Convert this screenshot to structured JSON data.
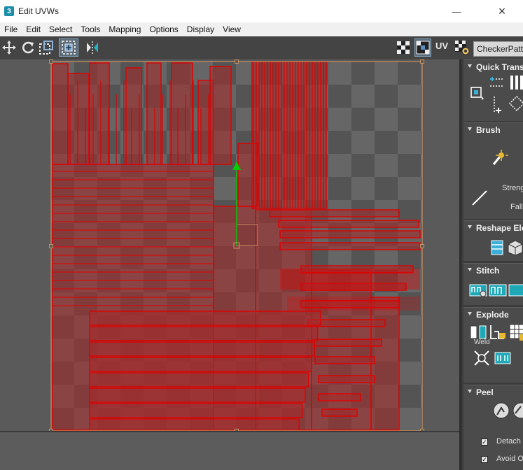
{
  "window": {
    "title": "Edit UVWs",
    "app_badge": "3",
    "close_glyph": "×",
    "minimize_glyph": "—"
  },
  "menu": [
    "File",
    "Edit",
    "Select",
    "Tools",
    "Mapping",
    "Options",
    "Display",
    "View"
  ],
  "toolbar": {
    "uv_label": "UV",
    "texture_dropdown": "CheckerPatt..."
  },
  "panel": {
    "quick_transform": "Quick Transf",
    "brush": "Brush",
    "strength_label": "Streng",
    "falloff_label": "Fallo",
    "reshape": "Reshape Ele",
    "stitch": "Stitch",
    "explode": "Explode",
    "weld": "Weld",
    "peel": "Peel",
    "detach_label": "Detach",
    "avoid_label": "Avoid Ov",
    "check_glyph": "✓"
  },
  "colors": {
    "uv_edge": "#e00000",
    "uv_fill": "rgba(170,40,40,0.55)",
    "gizmo": "#00cc00",
    "bounds": "#c89060"
  }
}
